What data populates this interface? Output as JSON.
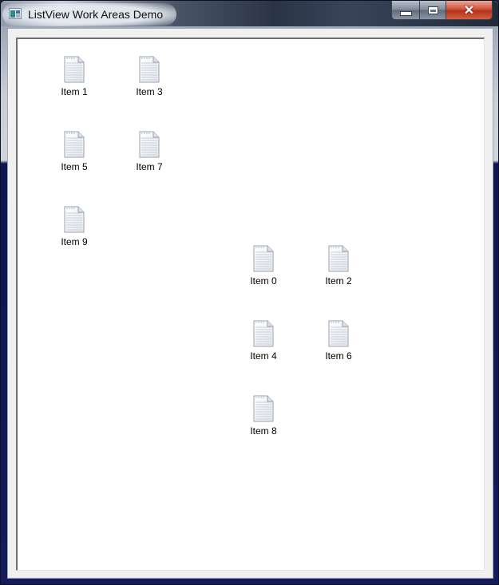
{
  "window": {
    "title": "ListView Work Areas Demo",
    "controls": {
      "minimize": "minimize",
      "maximize": "maximize",
      "close": "close"
    }
  },
  "listview": {
    "icon": "document-icon",
    "items": [
      {
        "label": "Item 0",
        "work_area": 2
      },
      {
        "label": "Item 1",
        "work_area": 1
      },
      {
        "label": "Item 2",
        "work_area": 2
      },
      {
        "label": "Item 3",
        "work_area": 1
      },
      {
        "label": "Item 4",
        "work_area": 2
      },
      {
        "label": "Item 5",
        "work_area": 1
      },
      {
        "label": "Item 6",
        "work_area": 2
      },
      {
        "label": "Item 7",
        "work_area": 1
      },
      {
        "label": "Item 8",
        "work_area": 2
      },
      {
        "label": "Item 9",
        "work_area": 1
      }
    ]
  }
}
